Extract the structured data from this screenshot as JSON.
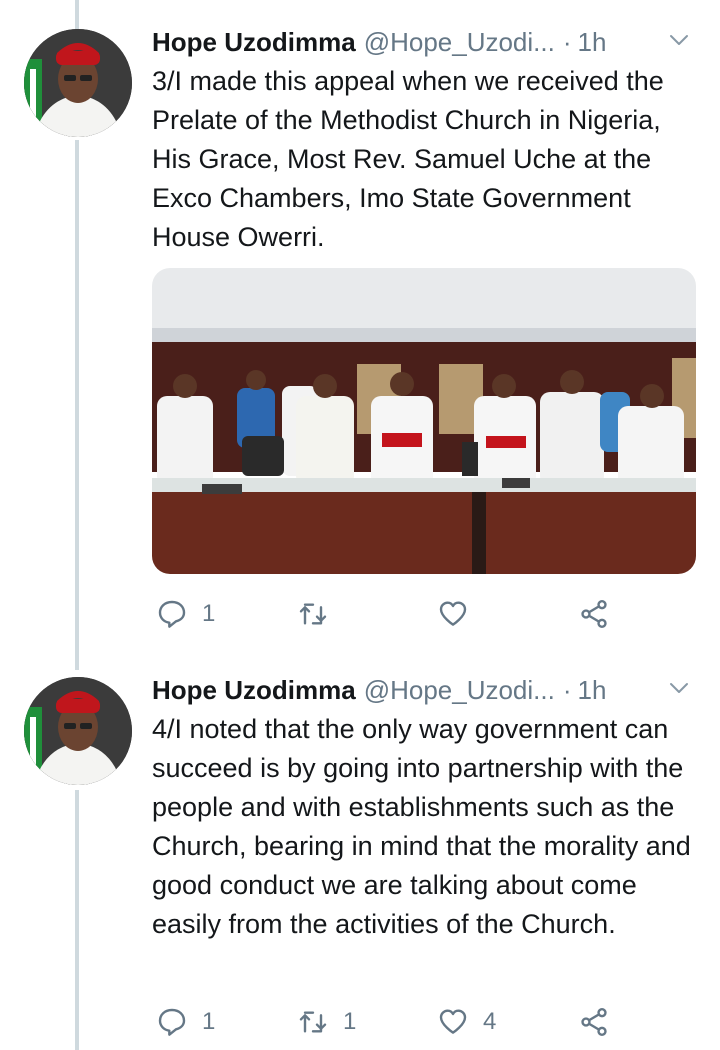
{
  "tweets": [
    {
      "author_name": "Hope Uzodimma",
      "author_handle": "@Hope_Uzodi...",
      "separator": "·",
      "time": "1h",
      "text": "3/I made this appeal when we received the Prelate of the Methodist Church in Nigeria, His Grace, Most Rev. Samuel Uche at the Exco Chambers, Imo State Government House Owerri.",
      "has_media": true,
      "replies": "1",
      "retweets": "",
      "likes": ""
    },
    {
      "author_name": "Hope Uzodimma",
      "author_handle": "@Hope_Uzodi...",
      "separator": "·",
      "time": "1h",
      "text": "4/I noted that the only way government can succeed is by going into partnership with the people and with establishments such as the Church, bearing in mind that the morality and good conduct we are talking about come easily from the activities of the Church.",
      "has_media": false,
      "replies": "1",
      "retweets": "1",
      "likes": "4"
    }
  ],
  "icons": {
    "reply": "reply-icon",
    "retweet": "retweet-icon",
    "like": "heart-icon",
    "share": "share-icon",
    "menu": "chevron-down-icon"
  },
  "colors": {
    "text": "#14171a",
    "secondary": "#657786",
    "thread_line": "#cfd9de"
  }
}
